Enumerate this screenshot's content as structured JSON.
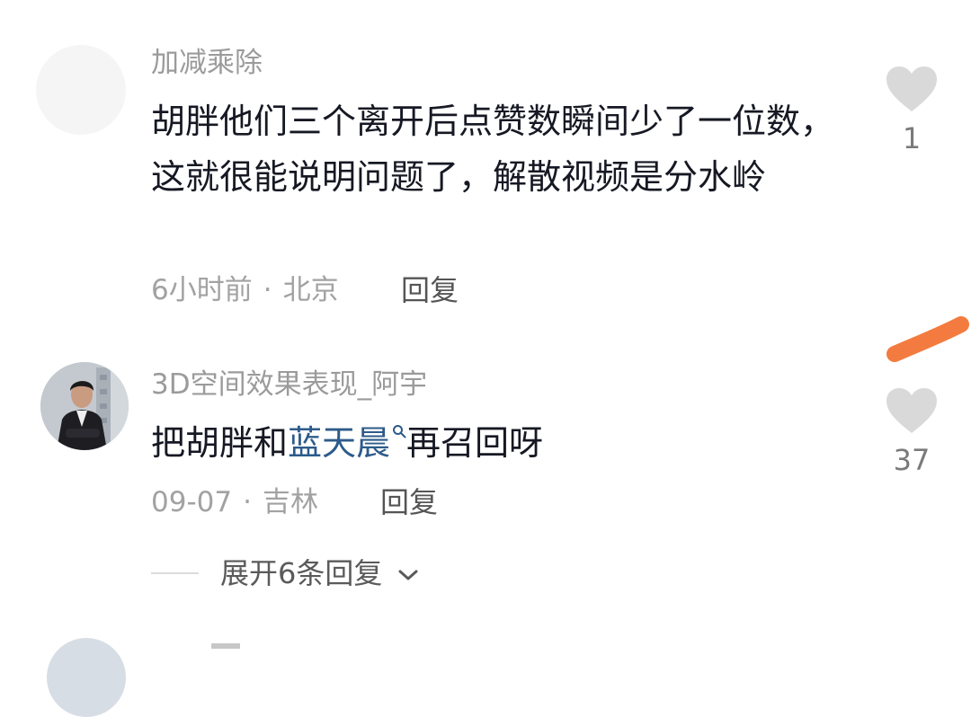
{
  "comments": [
    {
      "username": "加减乘除",
      "text": "胡胖他们三个离开后点赞数瞬间少了一位数，这就很能说明问题了，解散视频是分水岭",
      "time": "6小时前",
      "location": "北京",
      "reply_label": "回复",
      "likes": "1"
    },
    {
      "username": "3D空间效果表现_阿宇",
      "text_prefix": "把胡胖和",
      "link_text": "蓝天晨",
      "text_suffix": "再召回呀",
      "time": "09-07",
      "location": "吉林",
      "reply_label": "回复",
      "likes": "37",
      "expand_label": "展开6条回复"
    }
  ],
  "colors": {
    "username": "#9b9b9b",
    "text": "#161823",
    "link": "#2d5b8a",
    "heart": "#d9d9d9",
    "annotation": "#f47b3f"
  },
  "icons": {
    "like": "heart-icon",
    "link_search": "search-icon",
    "expand": "chevron-down-icon"
  }
}
